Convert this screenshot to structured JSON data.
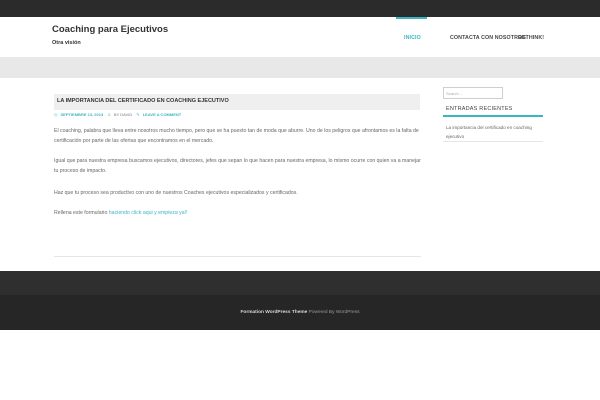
{
  "header": {
    "site_title": "Coaching para Ejecutivos",
    "site_description": "Otra visión"
  },
  "nav": {
    "items": [
      {
        "label": "INICIO",
        "active": true
      },
      {
        "label": "CONTACTA CON NOSOTROS",
        "active": false
      },
      {
        "label": "RETHINK!",
        "active": false
      }
    ]
  },
  "post": {
    "title": "LA IMPORTANCIA DEL CERTIFICADO EN COACHING EJECUTIVO",
    "meta": {
      "date": "SEPTIEMBRE 13, 2013",
      "author": "BY DAVID",
      "comment_link": "LEAVE A COMMENT"
    },
    "paragraphs": [
      "El coaching, palabra que lleva entre nosotros mucho tiempo, pero que se ha puesto tan de moda que aburre. Uno de los peligros que afrontamos es la falta de certificación por parte de las ofertas que encontramos en el mercado.",
      "Igual que para nuestra empresa buscamos ejecutivos, directores, jefes que sepan lo que hacen para nuestra empresa, lo mismo ocurre con quien va a manejar tu proceso de impacto.",
      "Haz que tu proceso sea productivo con uno de nuestros Coaches ejecutivos especializados y certificados."
    ],
    "cta_prefix": "Rellena este formulario ",
    "cta_link": "haciendo click aqui y empieza ya!!"
  },
  "sidebar": {
    "search_placeholder": "Search ...",
    "widget_title": "ENTRADAS RECIENTES",
    "recent_posts": [
      "La importancia del certificado en coaching ejecutivo"
    ]
  },
  "footer": {
    "theme_label": "Formation WordPress Theme",
    "powered_label": "Powered By WordPress"
  },
  "colors": {
    "accent": "#3bb5c2",
    "topbar": "#2b2b2b",
    "graybar": "#e8e8e8",
    "footer": "#2f2f2f"
  }
}
